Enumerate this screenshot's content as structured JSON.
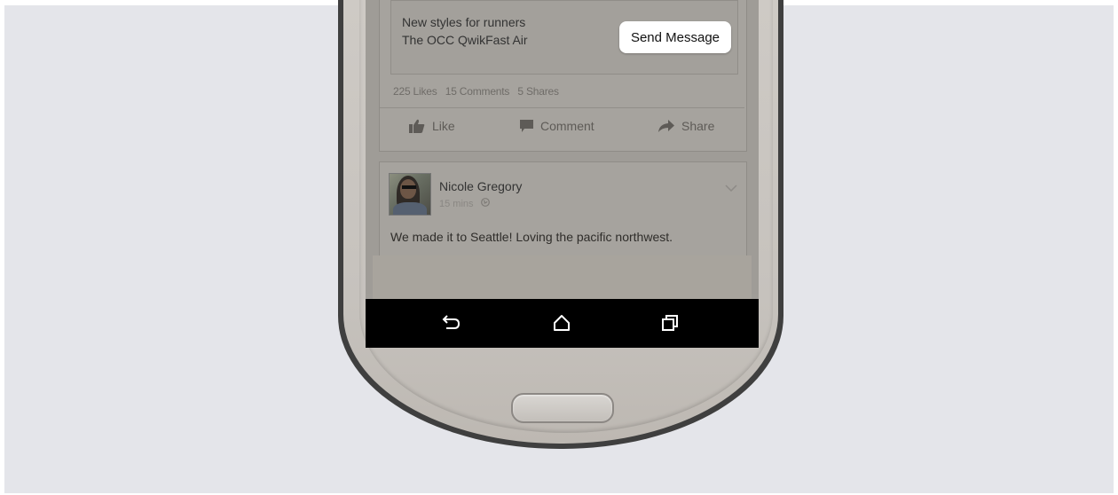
{
  "ad": {
    "title": "New styles for runners",
    "subtitle": "The OCC QwikFast Air",
    "cta_label": "Send Message"
  },
  "stats": {
    "likes": "225 Likes",
    "comments": "15 Comments",
    "shares": "5 Shares"
  },
  "actions": {
    "like_label": "Like",
    "comment_label": "Comment",
    "share_label": "Share"
  },
  "post": {
    "author": "Nicole Gregory",
    "time": "15 mins",
    "text": "We made it to Seattle! Loving the pacific northwest."
  },
  "icons": {
    "like": "thumbs-up-icon",
    "comment": "comment-icon",
    "share": "share-arrow-icon",
    "globe": "globe-icon",
    "chevron": "chevron-down-icon",
    "back": "back-icon",
    "home": "home-icon",
    "recents": "recent-apps-icon"
  },
  "colors": {
    "background": "#e4e5ea",
    "nav_bar": "#000000",
    "cta_button": "#ffffff"
  }
}
